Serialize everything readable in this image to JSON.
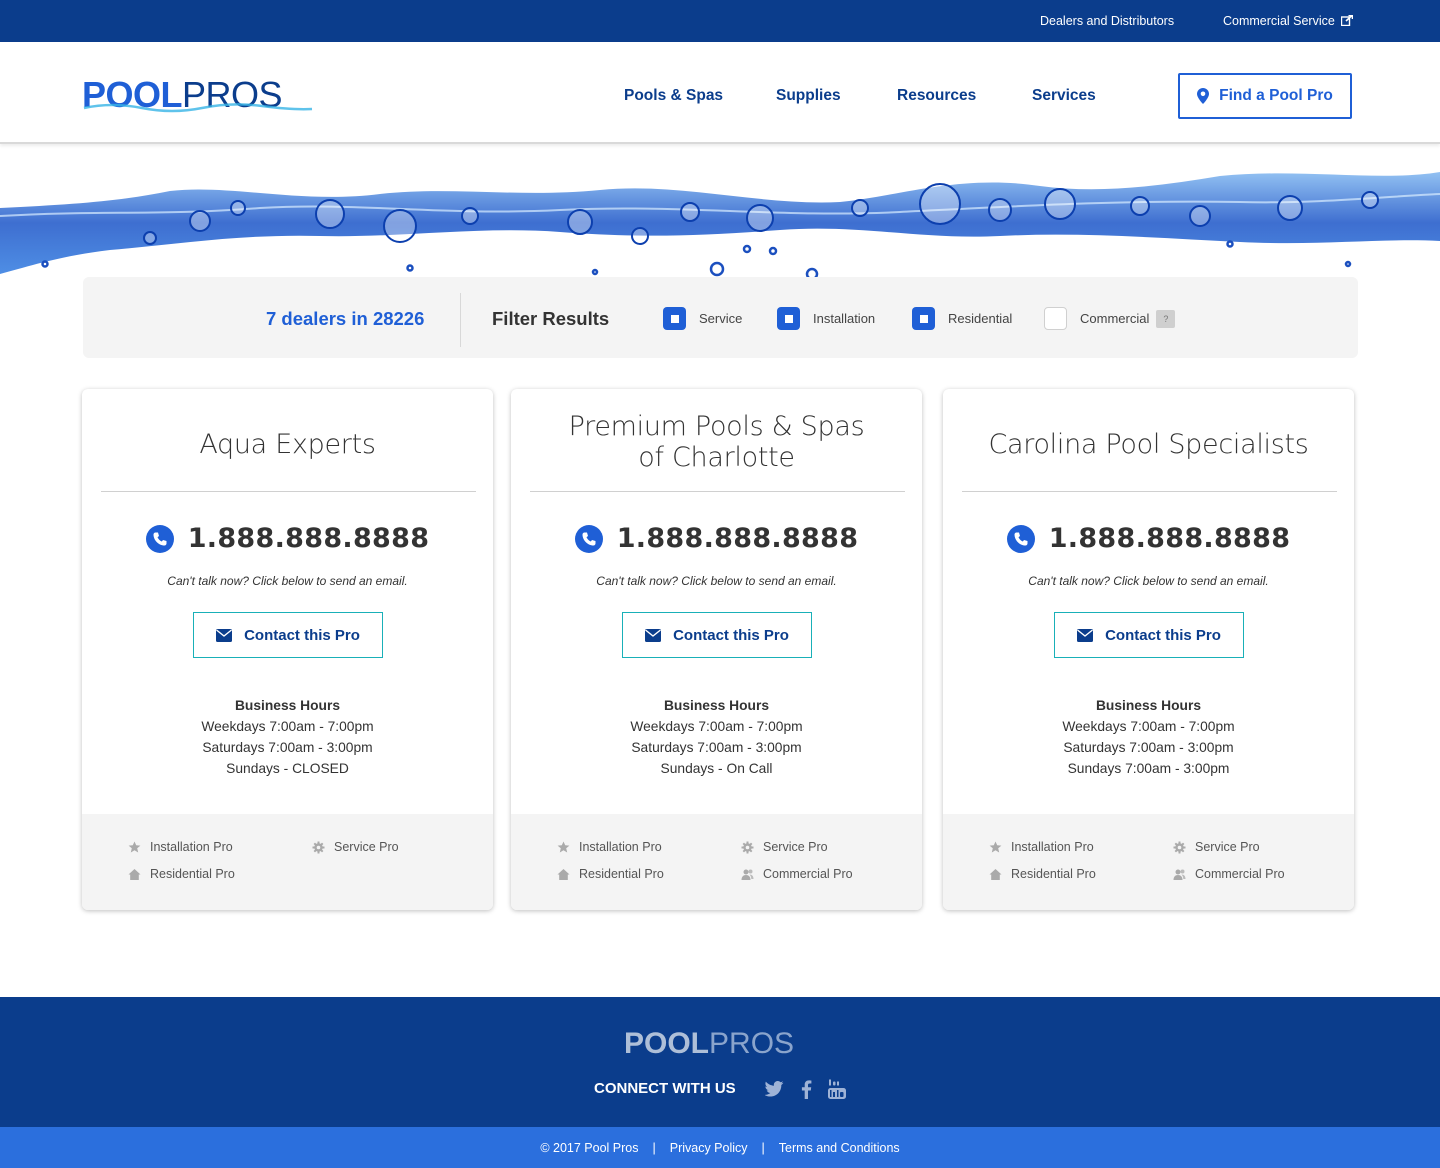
{
  "topbar": {
    "dealers_link": "Dealers and Distributors",
    "commercial_link": "Commercial Service"
  },
  "header": {
    "logo_pool": "POOL",
    "logo_pros": "PROS",
    "nav": [
      "Pools & Spas",
      "Supplies",
      "Resources",
      "Services"
    ],
    "find_button": "Find a Pool Pro"
  },
  "filter": {
    "count_text": "7 dealers in 28226",
    "title": "Filter Results",
    "options": [
      {
        "label": "Service",
        "checked": true
      },
      {
        "label": "Installation",
        "checked": true
      },
      {
        "label": "Residential",
        "checked": true
      },
      {
        "label": "Commercial",
        "checked": false
      }
    ],
    "help_label": "?"
  },
  "cards": [
    {
      "name_line1": "Aqua Experts",
      "name_line2": "",
      "phone": "1.888.888.8888",
      "cant_talk": "Can't talk now? Click below to send an email.",
      "contact_label": "Contact this Pro",
      "hours_title": "Business Hours",
      "hours": [
        "Weekdays 7:00am - 7:00pm",
        "Saturdays 7:00am - 3:00pm",
        "Sundays - CLOSED"
      ],
      "tags": [
        "Installation Pro",
        "Service Pro",
        "Residential Pro"
      ]
    },
    {
      "name_line1": "Premium Pools & Spas",
      "name_line2": "of Charlotte",
      "phone": "1.888.888.8888",
      "cant_talk": "Can't talk now? Click below to send an email.",
      "contact_label": "Contact this Pro",
      "hours_title": "Business Hours",
      "hours": [
        "Weekdays 7:00am - 7:00pm",
        "Saturdays 7:00am - 3:00pm",
        "Sundays - On Call"
      ],
      "tags": [
        "Installation Pro",
        "Service Pro",
        "Residential Pro",
        "Commercial Pro"
      ]
    },
    {
      "name_line1": "Carolina Pool Specialists",
      "name_line2": "",
      "phone": "1.888.888.8888",
      "cant_talk": "Can't talk now? Click below to send an email.",
      "contact_label": "Contact this Pro",
      "hours_title": "Business Hours",
      "hours": [
        "Weekdays 7:00am - 7:00pm",
        "Saturdays 7:00am - 3:00pm",
        "Sundays 7:00am - 3:00pm"
      ],
      "tags": [
        "Installation Pro",
        "Service Pro",
        "Residential Pro",
        "Commercial Pro"
      ]
    }
  ],
  "footer": {
    "logo_pool": "POOL",
    "logo_pros": "PROS",
    "connect_label": "CONNECT WITH US",
    "social": [
      "twitter-icon",
      "facebook-icon",
      "youtube-icon"
    ],
    "copyright": "© 2017 Pool Pros",
    "separator": "|",
    "privacy": "Privacy Policy",
    "terms": "Terms and Conditions"
  },
  "colors": {
    "navy": "#0b3d8c",
    "brand_blue": "#1f5fd6",
    "teal_border": "#19b0b8",
    "bottom_bar": "#2b6fdd"
  }
}
